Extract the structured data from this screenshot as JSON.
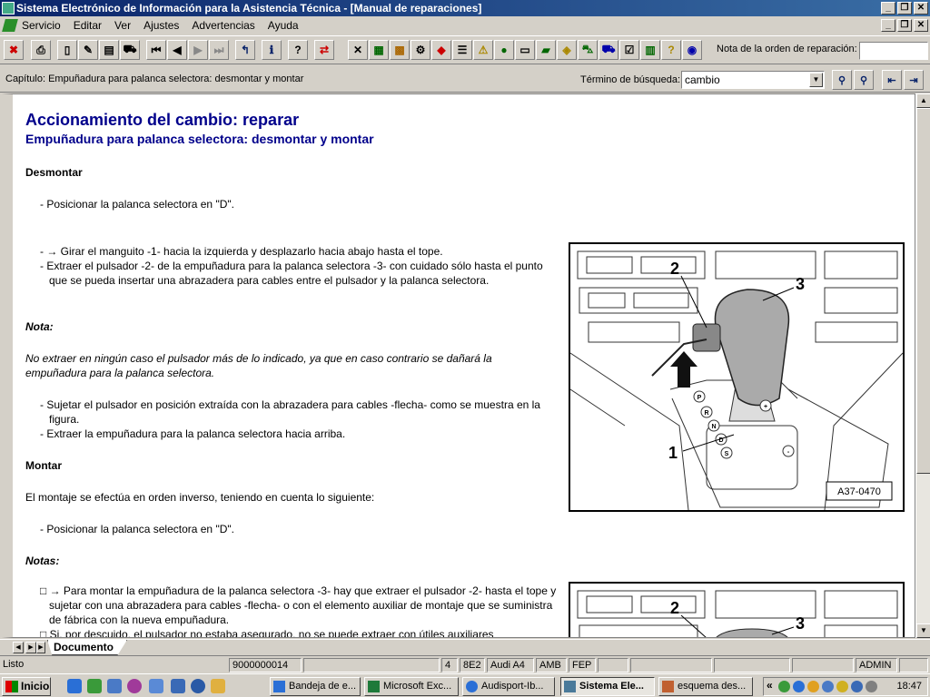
{
  "window": {
    "title": "Sistema Electrónico de Información para la Asistencia Técnica - [Manual de reparaciones]",
    "controls": [
      "_",
      "❐",
      "✕"
    ]
  },
  "menu": {
    "items": [
      "Servicio",
      "Editar",
      "Ver",
      "Ajustes",
      "Advertencias",
      "Ayuda"
    ],
    "controls": [
      "_",
      "❐",
      "✕"
    ]
  },
  "toolbar": {
    "nota_label": "Nota de la orden de reparación:",
    "nota_value": ""
  },
  "infobar": {
    "chapter": "Capítulo: Empuñadura para palanca selectora: desmontar y montar",
    "search_label": "Término de búsqueda:",
    "search_value": "cambio"
  },
  "document": {
    "title": "Accionamiento del cambio: reparar",
    "subtitle": "Empuñadura para palanca selectora: desmontar y montar",
    "desmontar_heading": "Desmontar",
    "steps1": [
      "- Posicionar la palanca selectora en \"D\"."
    ],
    "steps2": [
      "- → Girar el manguito -1- hacia la izquierda y desplazarlo hacia abajo hasta el tope.",
      "- Extraer el pulsador -2- de la empuñadura para la palanca selectora -3- con cuidado sólo hasta el punto que se pueda insertar una abrazadera para cables entre el pulsador y la palanca selectora."
    ],
    "nota_heading": "Nota:",
    "nota_text": "No extraer en ningún caso el pulsador más de lo indicado, ya que en caso contrario se dañará la empuñadura para la palanca selectora.",
    "steps3": [
      "- Sujetar el pulsador en posición extraída con la abrazadera para cables -flecha- como se muestra en la figura.",
      "- Extraer la empuñadura para la palanca selectora hacia arriba."
    ],
    "montar_heading": "Montar",
    "montar_text": "El montaje se efectúa en orden inverso, teniendo en cuenta lo siguiente:",
    "steps4": [
      "- Posicionar la palanca selectora en \"D\"."
    ],
    "notas_heading": "Notas:",
    "notas": [
      "□ → Para montar la empuñadura de la palanca selectora -3- hay que extraer el pulsador -2- hasta el tope y sujetar con una abrazadera para cables -flecha- o con el elemento auxiliar de montaje que se suministra de fábrica con la nueva empuñadura.",
      "□ Si, por descuido, el pulsador no estaba asegurado, no se puede extraer con útiles auxiliares"
    ],
    "figure1": {
      "code": "A37-0470",
      "labels": [
        "1",
        "2",
        "3"
      ],
      "gear_letters": [
        "P",
        "R",
        "N",
        "D",
        "S",
        "+",
        "-"
      ]
    },
    "figure2": {
      "labels": [
        "2",
        "3"
      ]
    }
  },
  "tabs": {
    "active": "Documento"
  },
  "status": {
    "fields": [
      "Listo",
      "9000000014",
      "4",
      "8E2",
      "Audi A4",
      "AMB",
      "FEP",
      "ADMIN"
    ]
  },
  "taskbar": {
    "start": "Inicio",
    "tasks": [
      "Bandeja de e...",
      "Microsoft Exc...",
      "Audisport-Ib...",
      "Sistema Ele...",
      "esquema des..."
    ],
    "clock": "18:47",
    "tray_expand": "«"
  }
}
